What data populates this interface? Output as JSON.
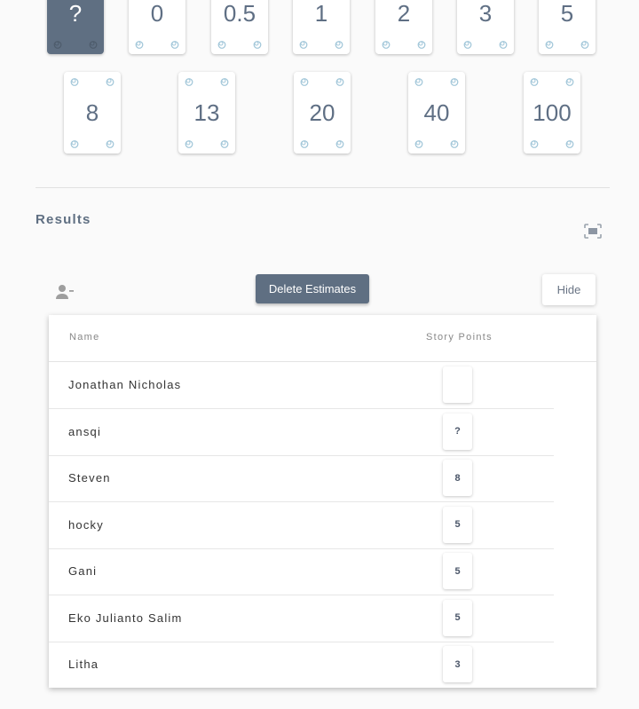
{
  "deck": {
    "row1": [
      {
        "value": "?",
        "selected": true
      },
      {
        "value": "0",
        "selected": false
      },
      {
        "value": "0.5",
        "selected": false
      },
      {
        "value": "1",
        "selected": false
      },
      {
        "value": "2",
        "selected": false
      },
      {
        "value": "3",
        "selected": false
      },
      {
        "value": "5",
        "selected": false
      }
    ],
    "row2": [
      {
        "value": "8",
        "selected": false
      },
      {
        "value": "13",
        "selected": false
      },
      {
        "value": "20",
        "selected": false
      },
      {
        "value": "40",
        "selected": false
      },
      {
        "value": "100",
        "selected": false
      }
    ]
  },
  "results": {
    "title": "Results",
    "delete_label": "Delete Estimates",
    "hide_label": "Hide",
    "icons": {
      "fullscreen": "fullscreen-icon",
      "remove_user": "person-remove-icon"
    },
    "table": {
      "headers": {
        "name": "Name",
        "points": "Story Points"
      },
      "rows": [
        {
          "name": "Jonathan Nicholas",
          "points": ""
        },
        {
          "name": "ansqi",
          "points": "?"
        },
        {
          "name": "Steven",
          "points": "8"
        },
        {
          "name": "hocky",
          "points": "5"
        },
        {
          "name": "Gani",
          "points": "5"
        },
        {
          "name": "Eko Julianto Salim",
          "points": "5"
        },
        {
          "name": "Litha",
          "points": "3"
        }
      ]
    }
  },
  "colors": {
    "accent": "#5f6f82",
    "pip": "#9fc5d8"
  }
}
